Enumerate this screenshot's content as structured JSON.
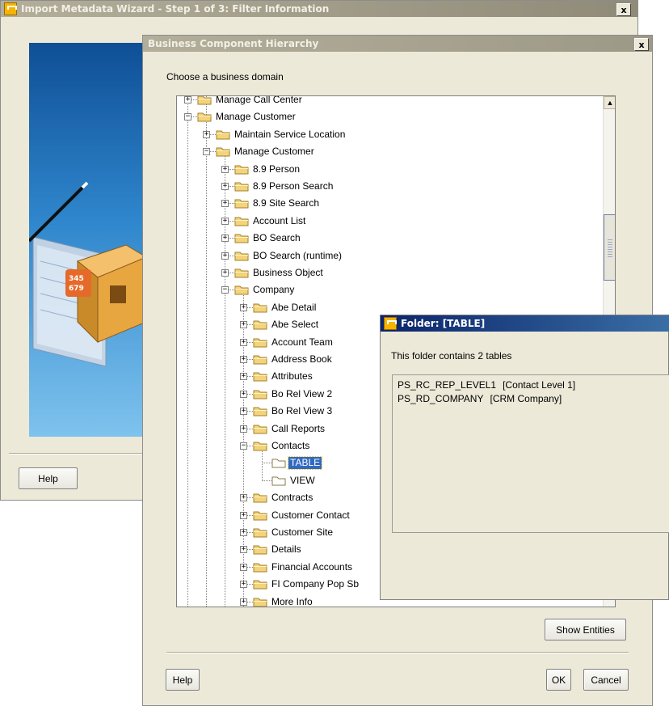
{
  "main_window": {
    "title": "Import Metadata Wizard - Step 1 of 3: Filter Information",
    "close_glyph": "x",
    "help_label": "Help"
  },
  "dialog": {
    "title": "Business Component Hierarchy",
    "close_glyph": "x",
    "domain_label": "Choose a business domain",
    "show_entities_label": "Show Entities",
    "help_label": "Help",
    "ok_label": "OK",
    "cancel_label": "Cancel"
  },
  "tree": {
    "nodes": [
      {
        "label": "Manage Call Center",
        "expander": "+"
      },
      {
        "label": "Manage Customer",
        "expander": "−"
      },
      {
        "label": "Maintain Service Location",
        "expander": "+"
      },
      {
        "label": "Manage Customer",
        "expander": "−"
      },
      {
        "label": "8.9 Person",
        "expander": "+"
      },
      {
        "label": "8.9 Person Search",
        "expander": "+"
      },
      {
        "label": "8.9 Site Search",
        "expander": "+"
      },
      {
        "label": "Account List",
        "expander": "+"
      },
      {
        "label": "BO Search",
        "expander": "+"
      },
      {
        "label": "BO Search (runtime)",
        "expander": "+"
      },
      {
        "label": "Business Object",
        "expander": "+"
      },
      {
        "label": "Company",
        "expander": "−"
      },
      {
        "label": "Abe Detail",
        "expander": "+"
      },
      {
        "label": "Abe Select",
        "expander": "+"
      },
      {
        "label": "Account Team",
        "expander": "+"
      },
      {
        "label": "Address Book",
        "expander": "+"
      },
      {
        "label": "Attributes",
        "expander": "+"
      },
      {
        "label": "Bo Rel View 2",
        "expander": "+"
      },
      {
        "label": "Bo Rel View 3",
        "expander": "+"
      },
      {
        "label": "Call Reports",
        "expander": "+"
      },
      {
        "label": "Contacts",
        "expander": "−"
      },
      {
        "label": "TABLE",
        "expander": ""
      },
      {
        "label": "VIEW",
        "expander": ""
      },
      {
        "label": "Contracts",
        "expander": "+"
      },
      {
        "label": "Customer Contact",
        "expander": "+"
      },
      {
        "label": "Customer Site",
        "expander": "+"
      },
      {
        "label": "Details",
        "expander": "+"
      },
      {
        "label": "Financial Accounts",
        "expander": "+"
      },
      {
        "label": "FI Company Pop Sb",
        "expander": "+"
      },
      {
        "label": "More Info",
        "expander": "+"
      }
    ],
    "scroll_up_glyph": "▲"
  },
  "folder_popup": {
    "title": "Folder: [TABLE]",
    "summary": "This folder contains 2 tables",
    "tables": [
      {
        "name": "PS_RC_REP_LEVEL1",
        "description": "[Contact Level 1]"
      },
      {
        "name": "PS_RD_COMPANY",
        "description": "[CRM Company]"
      }
    ]
  },
  "colors": {
    "inactive_title": "#a6a28f",
    "active_title": "#0a246a",
    "dialog_bg": "#ece9d8",
    "selection": "#316ac5",
    "folder_fill": "#f3d37c"
  }
}
